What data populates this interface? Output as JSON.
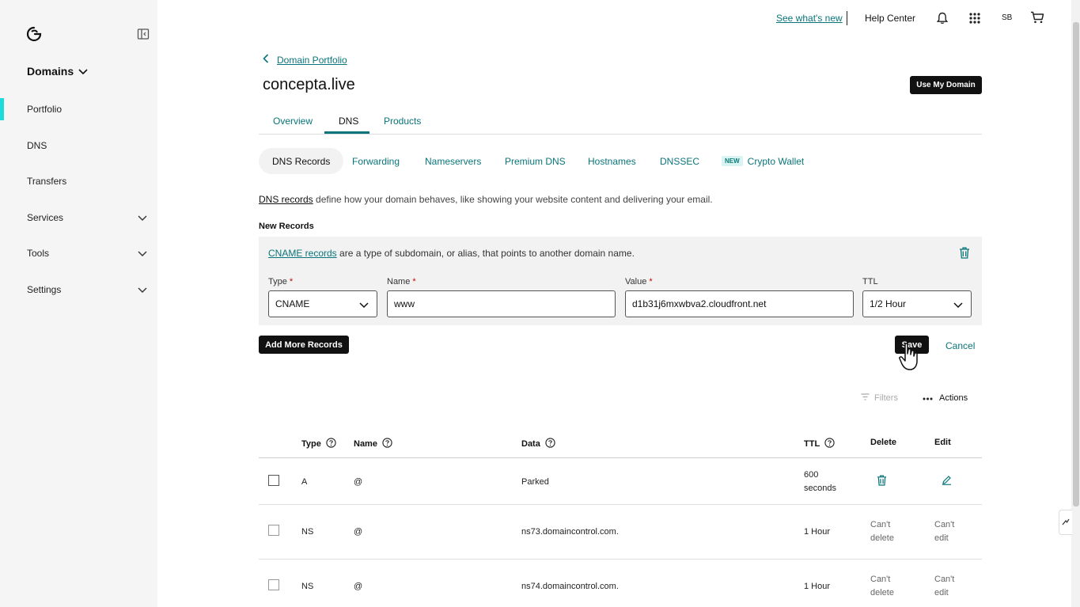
{
  "topbar": {
    "see_whats_new": "See what's new",
    "help_center": "Help Center",
    "initials": "SB"
  },
  "sidebar": {
    "product": "Domains",
    "items": [
      {
        "label": "Portfolio"
      },
      {
        "label": "DNS"
      },
      {
        "label": "Transfers"
      },
      {
        "label": "Services"
      },
      {
        "label": "Tools"
      },
      {
        "label": "Settings"
      }
    ]
  },
  "main": {
    "back_label": "Domain Portfolio",
    "title": "concepta.live",
    "use_domain_button": "Use My Domain",
    "tabs": [
      {
        "label": "Overview"
      },
      {
        "label": "DNS"
      },
      {
        "label": "Products"
      }
    ],
    "subtabs": [
      {
        "label": "DNS Records"
      },
      {
        "label": "Forwarding"
      },
      {
        "label": "Nameservers"
      },
      {
        "label": "Premium DNS"
      },
      {
        "label": "Hostnames"
      },
      {
        "label": "DNSSEC"
      },
      {
        "label": "Crypto Wallet",
        "badge": "NEW"
      }
    ],
    "intro_link": "DNS records",
    "intro_text": " define how your domain behaves, like showing your website content and delivering your email.",
    "new_records_heading": "New Records"
  },
  "new_record": {
    "desc_link": "CNAME records",
    "desc_text": " are a type of subdomain, or alias, that points to another domain name.",
    "type_label": "Type",
    "type_value": "CNAME",
    "name_label": "Name",
    "name_value": "www",
    "value_label": "Value",
    "value_value": "d1b31j6mxwbva2.cloudfront.net",
    "ttl_label": "TTL",
    "ttl_value": "1/2 Hour",
    "required_mark": "*"
  },
  "buttons": {
    "add_more": "Add More Records",
    "save": "Save",
    "cancel": "Cancel",
    "filters": "Filters",
    "actions": "Actions"
  },
  "table": {
    "headers": {
      "type": "Type",
      "name": "Name",
      "data": "Data",
      "ttl": "TTL",
      "delete": "Delete",
      "edit": "Edit"
    },
    "rows": [
      {
        "type": "A",
        "name": "@",
        "data": "Parked",
        "ttl_line1": "600",
        "ttl_line2": "seconds"
      },
      {
        "type": "NS",
        "name": "@",
        "data": "ns73.domaincontrol.com.",
        "ttl": "1 Hour",
        "delete_line1": "Can't",
        "delete_line2": "delete",
        "edit_line1": "Can't",
        "edit_line2": "edit"
      },
      {
        "type": "NS",
        "name": "@",
        "data": "ns74.domaincontrol.com.",
        "ttl": "1 Hour",
        "delete_line1": "Can't",
        "delete_line2": "delete",
        "edit_line1": "Can't",
        "edit_line2": "edit"
      }
    ]
  },
  "colors": {
    "accent": "#09757a",
    "active_marker": "#1bdbdb",
    "sidebar_bg": "#f5f5f5",
    "primary_button": "#111111"
  }
}
